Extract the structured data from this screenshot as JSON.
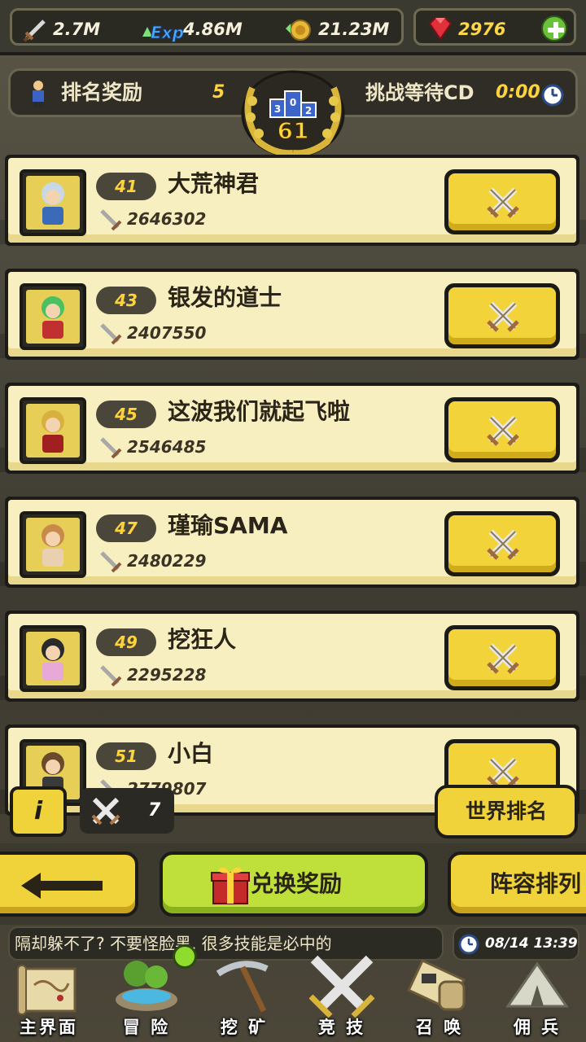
{
  "currency": {
    "attack": "2.7M",
    "exp_icon_text": "Exp",
    "exp": "4.86M",
    "gold": "21.23M",
    "gems": "2976"
  },
  "header": {
    "rank_reward_label": "排名奖励",
    "rank_reward_value": "5",
    "my_rank": "61",
    "podium": [
      "3",
      "0",
      "2"
    ],
    "cd_label": "挑战等待CD",
    "cd_value": "0:00"
  },
  "opponents": [
    {
      "rank": "41",
      "name": "大荒神君",
      "power": "2646302"
    },
    {
      "rank": "43",
      "name": "银发的道士",
      "power": "2407550"
    },
    {
      "rank": "45",
      "name": "这波我们就起飞啦",
      "power": "2546485"
    },
    {
      "rank": "47",
      "name": "瑾瑜SAMA",
      "power": "2480229"
    },
    {
      "rank": "49",
      "name": "挖狂人",
      "power": "2295228"
    },
    {
      "rank": "51",
      "name": "小白",
      "power": "2779807"
    }
  ],
  "info_label": "i",
  "attempts": "7",
  "world_rank_label": "世界排名",
  "bottom_buttons": {
    "exchange": "兑换奖励",
    "lineup": "阵容排列"
  },
  "ticker": "隔却躲不了? 不要怪脸黑, 很多技能是必中的",
  "datetime": "08/14 13:39",
  "nav": [
    {
      "label": "主界面",
      "icon": "map-scroll-icon"
    },
    {
      "label": "冒 险",
      "icon": "island-icon"
    },
    {
      "label": "挖 矿",
      "icon": "pickaxe-icon"
    },
    {
      "label": "竞 技",
      "icon": "crossed-swords-icon"
    },
    {
      "label": "召 唤",
      "icon": "summon-scroll-icon"
    },
    {
      "label": "佣 兵",
      "icon": "tent-icon"
    }
  ],
  "colors": {
    "accent_yellow": "#f0d23a",
    "card_bg": "#f7efc0",
    "rank_text": "#ffd43b"
  }
}
